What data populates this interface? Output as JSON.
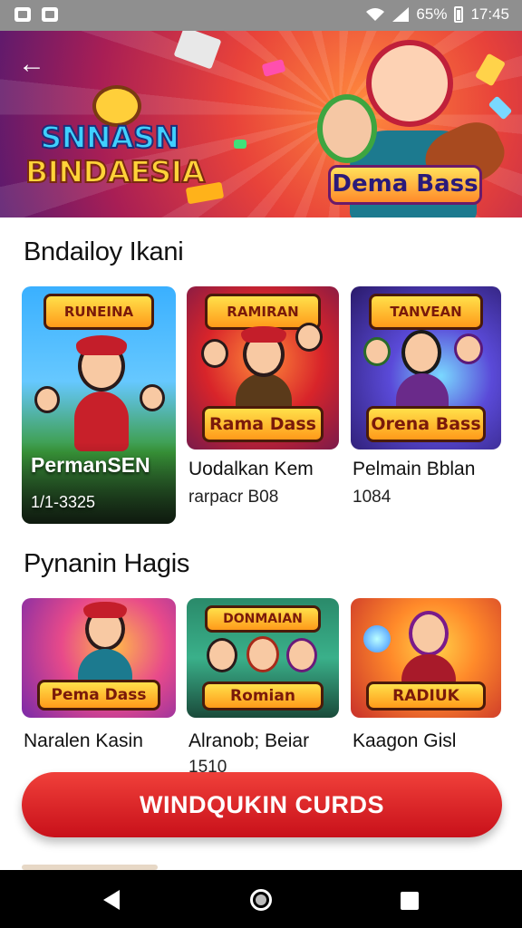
{
  "status_bar": {
    "battery_text": "65%",
    "time": "17:45",
    "icons": [
      "gallery-icon",
      "photos-icon",
      "wifi-icon",
      "signal-icon",
      "battery-icon"
    ]
  },
  "header": {
    "back_icon": "back-arrow-icon",
    "logo_line1": "SNNASN",
    "logo_line2": "BINDAESIA",
    "hero_brand": "Dema Bass"
  },
  "section1": {
    "title": "Bndailoy Ikani",
    "cards": [
      {
        "banner": "RUNEINA",
        "overlay_title": "PermanSEN",
        "overlay_sub": "1/1-3325",
        "name": "",
        "meta": ""
      },
      {
        "banner": "RAMIRAN",
        "bottom_label": "Rama Dass",
        "name": "Uodalkan Kem",
        "meta": "rarpacr B08"
      },
      {
        "banner": "TANVEAN",
        "bottom_label": "Orena Bass",
        "name": "Pelmain Bblan",
        "meta": "1084"
      }
    ]
  },
  "section2": {
    "title": "Pynanin Hagis",
    "cards": [
      {
        "bottom_label": "Pema Dass",
        "name": "Naralen Kasin",
        "meta": ""
      },
      {
        "banner": "DONMAIAN",
        "bottom_label": "Romian",
        "name": "Alranob; Beiar",
        "meta": "1510"
      },
      {
        "bottom_label": "RADIUK",
        "name": "Kaagon Gisl",
        "meta": ""
      }
    ]
  },
  "cta": {
    "label": "WINDQUKIN CURDS"
  },
  "colors": {
    "accent": "#e3262d",
    "hero_red": "#e8423a",
    "hero_purple": "#5a1a6e"
  }
}
